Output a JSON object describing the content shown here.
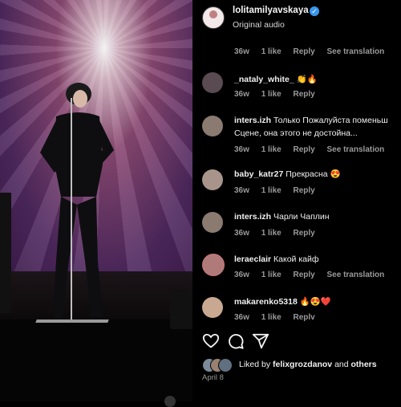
{
  "post": {
    "username": "lolitamilyavskaya",
    "audio": "Original audio",
    "verified_glyph": "✓"
  },
  "comments": [
    {
      "user": "",
      "text": "",
      "time": "36w",
      "likes": "1 like",
      "reply": "Reply",
      "translate": "See translation",
      "avatar": "none"
    },
    {
      "user": "_nataly_white_",
      "text": "👏🔥",
      "time": "36w",
      "likes": "1 like",
      "reply": "Reply",
      "translate": "",
      "avatar": "#5a4a52"
    },
    {
      "user": "inters.izh",
      "text": "Только Пожалуйста поменьш",
      "text2": "Сцене, она этого не достойна...",
      "time": "36w",
      "likes": "1 like",
      "reply": "Reply",
      "translate": "See translation",
      "avatar": "#8a7a70"
    },
    {
      "user": "baby_katr27",
      "text": "Прекрасна 😍",
      "time": "36w",
      "likes": "1 like",
      "reply": "Reply",
      "translate": "",
      "avatar": "#a8948a"
    },
    {
      "user": "inters.izh",
      "text": "Чарли Чаплин",
      "time": "36w",
      "likes": "1 like",
      "reply": "Reply",
      "translate": "",
      "avatar": "#8a7a70"
    },
    {
      "user": "leraeclair",
      "text": "Какой кайф",
      "time": "36w",
      "likes": "1 like",
      "reply": "Reply",
      "translate": "See translation",
      "avatar": "#b07a7a"
    },
    {
      "user": "makarenko5318",
      "text": "🔥😍❤️",
      "time": "36w",
      "likes": "1 like",
      "reply": "Replv",
      "translate": "",
      "avatar": "#c8a890"
    }
  ],
  "footer": {
    "liked_prefix": "Liked by",
    "liked_user": "felixgrozdanov",
    "liked_and": "and",
    "liked_others": "others",
    "date": "April 8"
  },
  "icons": [
    "heart-icon",
    "comment-icon",
    "share-icon"
  ],
  "colors": {
    "verified": "#3897f0",
    "muted": "#9a9a9a",
    "background": "#000000"
  }
}
